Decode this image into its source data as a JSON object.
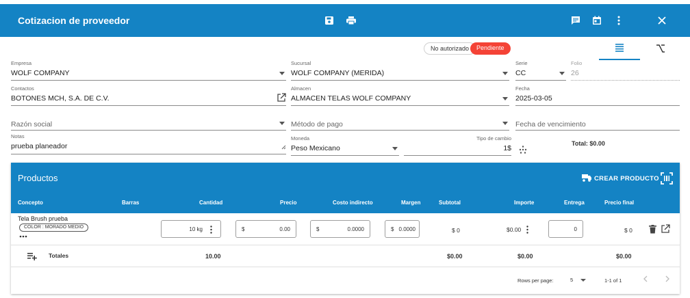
{
  "header": {
    "title": "Cotizacion de proveedor",
    "icons": [
      "save-icon",
      "print-icon",
      "comment-icon",
      "calendar-icon",
      "more-vert-icon",
      "close-icon"
    ]
  },
  "status": {
    "authorization": "No autorizado",
    "state": "Pendiente",
    "state_color": "#f44336"
  },
  "view_tabs": [
    "list-view-icon",
    "fork-view-icon"
  ],
  "form": {
    "empresa": {
      "label": "Empresa",
      "value": "WOLF COMPANY"
    },
    "sucursal": {
      "label": "Sucursal",
      "value": "WOLF COMPANY (MERIDA)"
    },
    "serie": {
      "label": "Serie",
      "value": "CC"
    },
    "folio": {
      "label": "Folio",
      "value": "26"
    },
    "contactos": {
      "label": "Contactos",
      "value": "BOTONES MCH, S.A. DE C.V."
    },
    "almacen": {
      "label": "Almacen",
      "value": "ALMACEN TELAS WOLF COMPANY"
    },
    "fecha": {
      "label": "Fecha",
      "value": "2025-03-05"
    },
    "razon_social": {
      "placeholder": "Razón social"
    },
    "metodo_pago": {
      "placeholder": "Método de pago"
    },
    "fecha_vencimiento": {
      "placeholder": "Fecha de vencimiento"
    },
    "notas": {
      "label": "Notas",
      "value": "prueba planeador"
    },
    "moneda": {
      "label": "Moneda",
      "value": "Peso Mexicano"
    },
    "tipo_cambio": {
      "label": "Tipo de cambio",
      "value": "1$"
    },
    "total": "Total: $0.00"
  },
  "products": {
    "title": "Productos",
    "create_label": "CREAR PRODUCTO",
    "columns": [
      "Concepto",
      "Barras",
      "Cantidad",
      "Precio",
      "Costo indirecto",
      "Margen",
      "Subtotal",
      "Importe",
      "Entrega",
      "Precio final"
    ],
    "row": {
      "concept": "Tela Brush prueba",
      "attribute": "COLOR : MORADO MEDIO",
      "cantidad": "10 kg",
      "precio_prefix": "$",
      "precio": "0.00",
      "costo_prefix": "$",
      "costo": "0.0000",
      "margen_prefix": "$",
      "margen": "0.0000",
      "subtotal": "$ 0",
      "importe": "$0.00",
      "entrega": "0",
      "precio_final": "$ 0"
    },
    "totals": {
      "label": "Totales",
      "cantidad": "10.00",
      "subtotal": "$0.00",
      "importe": "$0.00",
      "precio_final": "$0.00"
    },
    "pagination": {
      "rows_per_page_label": "Rows per page:",
      "rows_per_page": "5",
      "range": "1-1 of 1"
    }
  },
  "colors": {
    "primary": "#1483c4",
    "danger": "#f44336"
  }
}
